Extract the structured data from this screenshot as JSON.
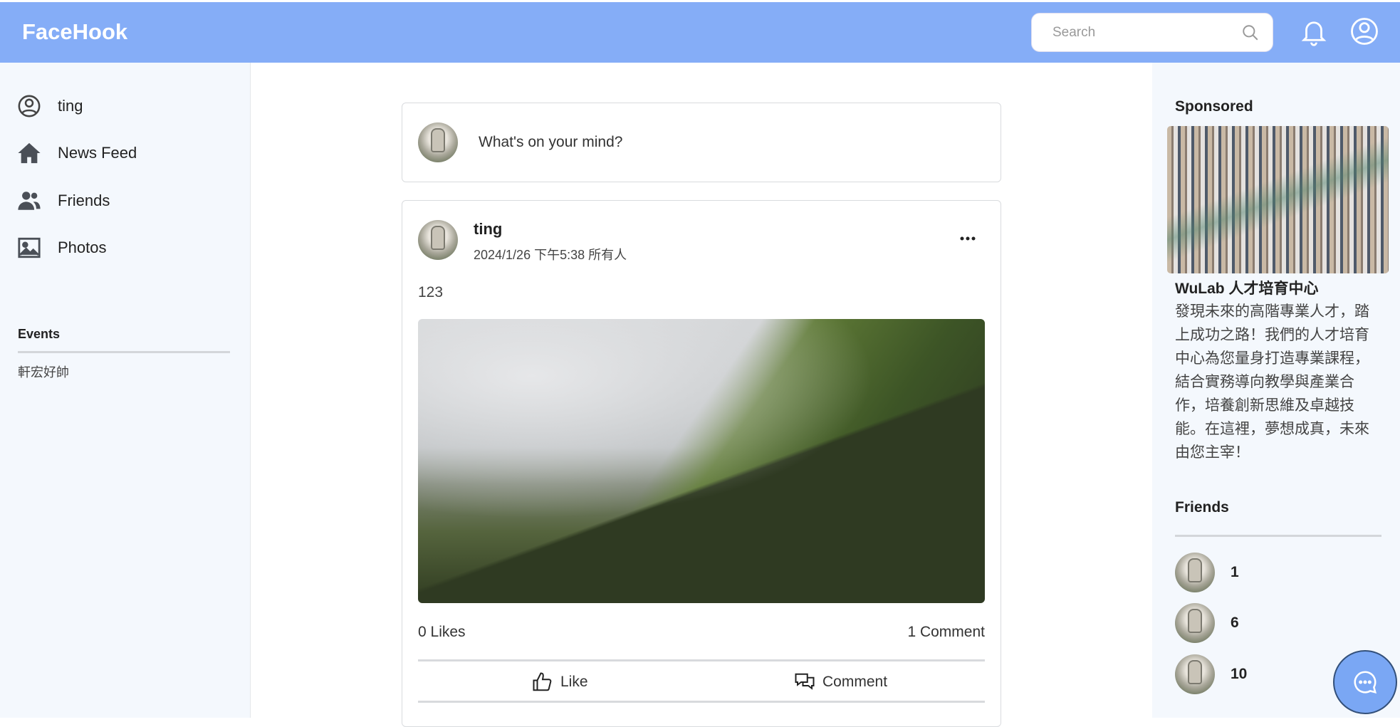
{
  "header": {
    "logo": "FaceHook",
    "search_placeholder": "Search",
    "accent": "#85adf7"
  },
  "sidebar": {
    "items": [
      {
        "label": "ting",
        "icon": "user-circle-icon"
      },
      {
        "label": "News Feed",
        "icon": "home-icon"
      },
      {
        "label": "Friends",
        "icon": "users-icon"
      },
      {
        "label": "Photos",
        "icon": "image-icon"
      }
    ],
    "events_heading": "Events",
    "events": [
      "軒宏好帥"
    ]
  },
  "composer": {
    "placeholder": "What's on your mind?"
  },
  "post": {
    "author": "ting",
    "meta": "2024/1/26 下午5:38 所有人",
    "text": "123",
    "likes": "0 Likes",
    "comments": "1 Comment",
    "like_label": "Like",
    "comment_label": "Comment"
  },
  "right": {
    "sponsored_heading": "Sponsored",
    "ad_title": "WuLab 人才培育中心",
    "ad_desc": "發現未來的高階專業人才，踏上成功之路！我們的人才培育中心為您量身打造專業課程，結合實務導向教學與產業合作，培養創新思維及卓越技能。在這裡，夢想成真，未來由您主宰！",
    "friends_heading": "Friends",
    "friends": [
      "1",
      "6",
      "10"
    ]
  }
}
